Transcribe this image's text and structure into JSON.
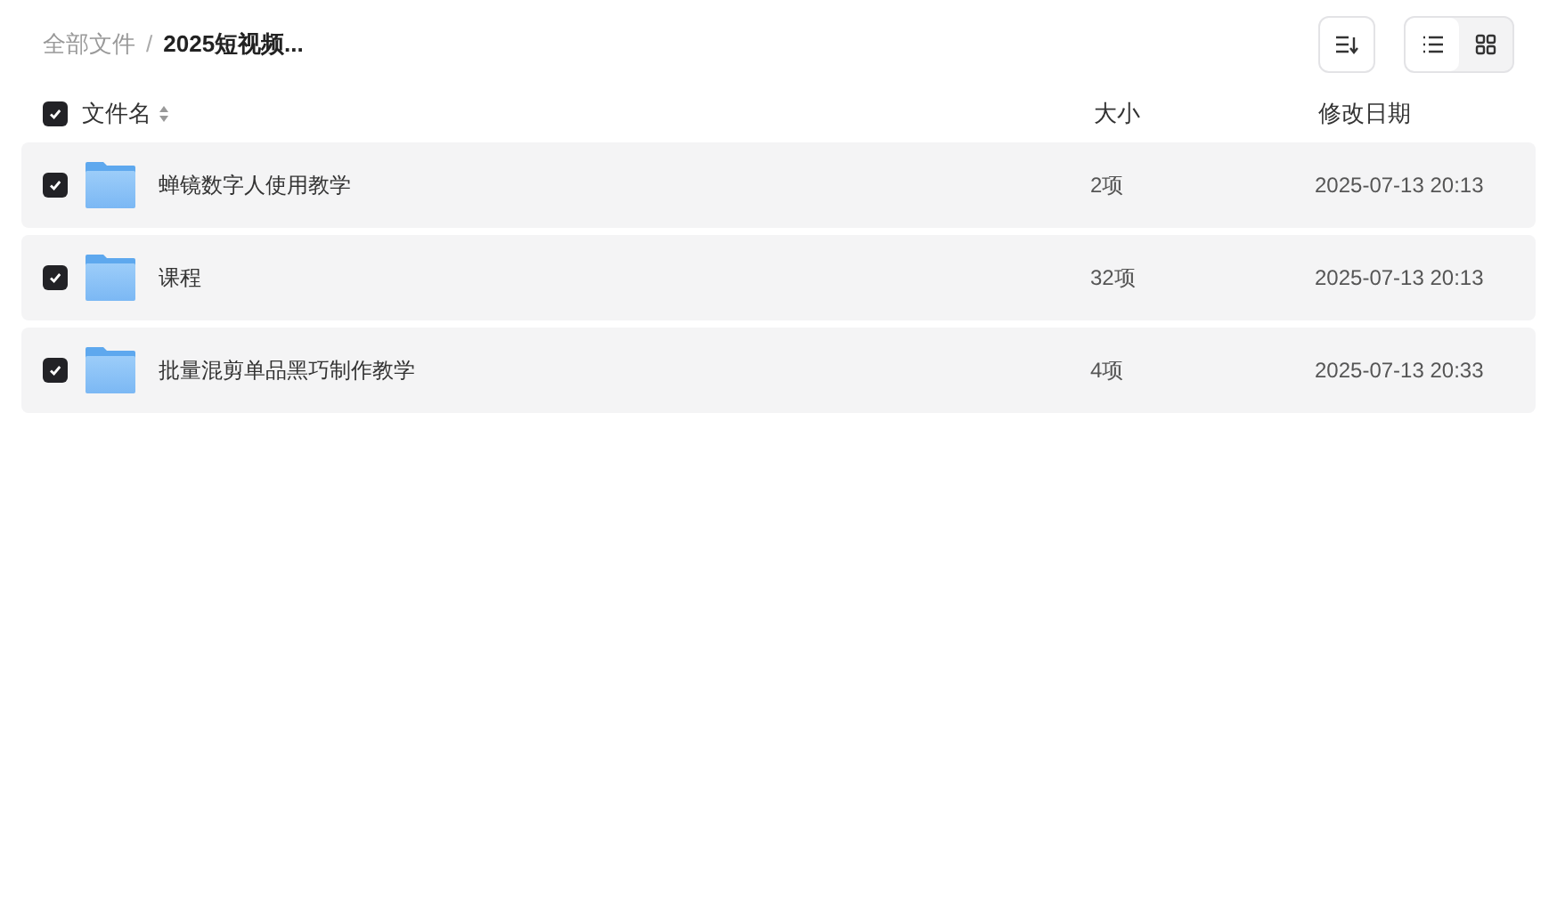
{
  "breadcrumb": [
    {
      "label": "全部文件",
      "current": false
    },
    {
      "separator": "/"
    },
    {
      "label": "2025短视频...",
      "current": true
    }
  ],
  "toolbar": {
    "view_modes": [
      {
        "kind": "list",
        "selected": true
      },
      {
        "kind": "grid",
        "selected": false
      }
    ]
  },
  "table": {
    "select_all": {
      "checked": true
    },
    "columns": [
      "文件名",
      "大小",
      "修改日期"
    ],
    "rows": [
      {
        "name": "蝉镜数字人使用教学",
        "size": "2项",
        "modified": "2025-07-13 20:13",
        "checked": true
      },
      {
        "name": "课程",
        "size": "32项",
        "modified": "2025-07-13 20:13",
        "checked": true
      },
      {
        "name": "批量混剪单品黑巧制作教学",
        "size": "4项",
        "modified": "2025-07-13 20:33",
        "checked": true
      }
    ]
  }
}
